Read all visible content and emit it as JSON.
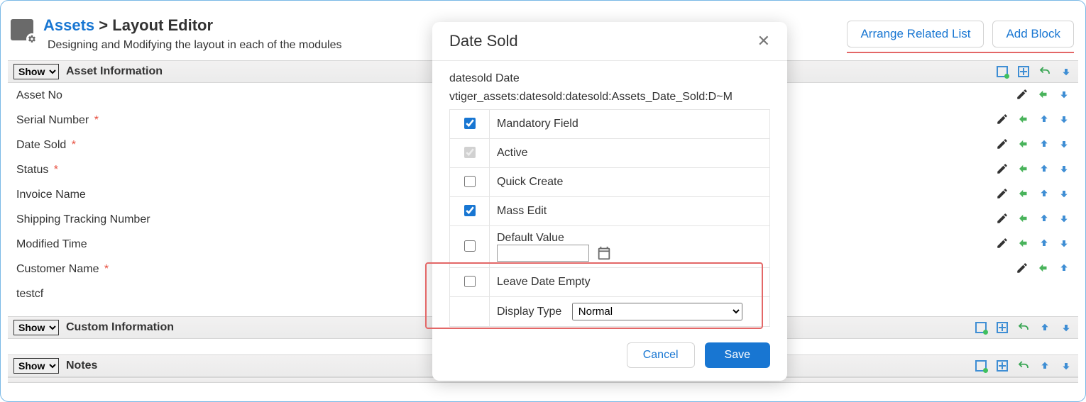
{
  "breadcrumbs": {
    "module": "Assets",
    "sep": ">",
    "page": "Layout Editor"
  },
  "subtitle": "Designing and Modifying the layout in each of the modules",
  "actions": {
    "arrange": "Arrange Related List",
    "add_block": "Add Block"
  },
  "common": {
    "show_option": "Show"
  },
  "blocks": [
    {
      "title": "Asset Information",
      "fields": [
        {
          "label": "Asset No",
          "mandatory": false,
          "tools": [
            "edit",
            "left",
            "down"
          ]
        },
        {
          "label": "Serial Number",
          "mandatory": true,
          "tools": [
            "edit",
            "left",
            "up",
            "down"
          ]
        },
        {
          "label": "Date Sold",
          "mandatory": true,
          "tools": [
            "edit",
            "left",
            "up",
            "down"
          ]
        },
        {
          "label": "Status",
          "mandatory": true,
          "tools": [
            "edit",
            "left",
            "up",
            "down"
          ]
        },
        {
          "label": "Invoice Name",
          "mandatory": false,
          "tools": [
            "edit",
            "left",
            "up",
            "down"
          ]
        },
        {
          "label": "Shipping Tracking Number",
          "mandatory": false,
          "tools": [
            "edit",
            "left",
            "up",
            "down"
          ]
        },
        {
          "label": "Modified Time",
          "mandatory": false,
          "tools": [
            "edit",
            "left",
            "up",
            "down"
          ]
        },
        {
          "label": "Customer Name",
          "mandatory": true,
          "tools": [
            "edit",
            "left",
            "up"
          ]
        },
        {
          "label": "testcf",
          "mandatory": false,
          "tools": []
        }
      ]
    },
    {
      "title": "Custom Information",
      "fields": []
    },
    {
      "title": "Notes",
      "fields": []
    }
  ],
  "modal": {
    "title": "Date Sold",
    "name_line": "datesold Date",
    "path_line": "vtiger_assets:datesold:datesold:Assets_Date_Sold:D~M",
    "props": {
      "mandatory": "Mandatory Field",
      "active": "Active",
      "quick_create": "Quick Create",
      "mass_edit": "Mass Edit",
      "default_value": "Default Value",
      "leave_empty": "Leave Date Empty",
      "display_type": "Display Type"
    },
    "checked": {
      "mandatory": true,
      "active": true,
      "quick_create": false,
      "mass_edit": true,
      "default_value": false,
      "leave_empty": false
    },
    "display_type_selected": "Normal",
    "default_value_text": "",
    "buttons": {
      "cancel": "Cancel",
      "save": "Save"
    }
  }
}
